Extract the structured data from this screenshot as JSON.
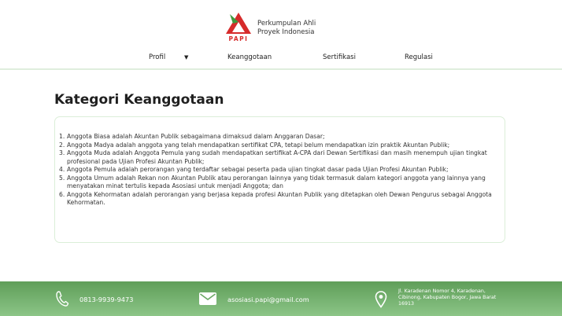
{
  "brand": {
    "logo_text": "PAPI",
    "name_line1": "Perkumpulan Ahli",
    "name_line2": "Proyek Indonesia"
  },
  "nav": {
    "items": [
      {
        "label": "Profil",
        "has_dropdown": true
      },
      {
        "label": "Keanggotaan"
      },
      {
        "label": "Sertifikasi"
      },
      {
        "label": "Regulasi"
      }
    ]
  },
  "main": {
    "title": "Kategori Keanggotaan",
    "categories": [
      {
        "num": "1.",
        "text": "Anggota Biasa adalah Akuntan Publik sebagaimana dimaksud dalam Anggaran Dasar;"
      },
      {
        "num": "2.",
        "text": "Anggota Madya adalah anggota yang telah mendapatkan sertifikat CPA, tetapi belum mendapatkan izin praktik Akuntan Publik;"
      },
      {
        "num": "3.",
        "text": "Anggota Muda adalah Anggota Pemula yang sudah mendapatkan sertifikat A-CPA dari Dewan Sertifikasi dan masih menempuh ujian tingkat profesional pada Ujian Profesi Akuntan Publik;"
      },
      {
        "num": "4.",
        "text": "Anggota Pemula adalah perorangan yang terdaftar sebagai peserta pada ujian tingkat dasar pada Ujian Profesi Akuntan Publik;"
      },
      {
        "num": "5.",
        "text": "Anggota Umum adalah Rekan non Akuntan Publik atau perorangan lainnya yang tidak termasuk dalam kategori anggota yang lainnya yang menyatakan minat tertulis kepada Asosiasi untuk menjadi Anggota; dan"
      },
      {
        "num": "6.",
        "text": "Anggota Kehormatan adalah perorangan yang berjasa kepada profesi Akuntan Publik yang ditetapkan oleh Dewan Pengurus sebagai Anggota Kehormatan."
      }
    ]
  },
  "footer": {
    "phone": "0813-9939-9473",
    "email": "asosiasi.papi@gmail.com",
    "address": "Jl. Karadenan Nomor 4, Karadenan, Cibinong, Kabupaten Bogor, Jawa Barat 16913"
  },
  "colors": {
    "brand_red": "#d62b2b",
    "brand_green": "#5f9e59",
    "card_border": "#dbeed8"
  },
  "icons": {
    "phone": "phone-icon",
    "email": "mail-icon",
    "address": "location-pin-icon",
    "dropdown": "caret-down-icon"
  }
}
